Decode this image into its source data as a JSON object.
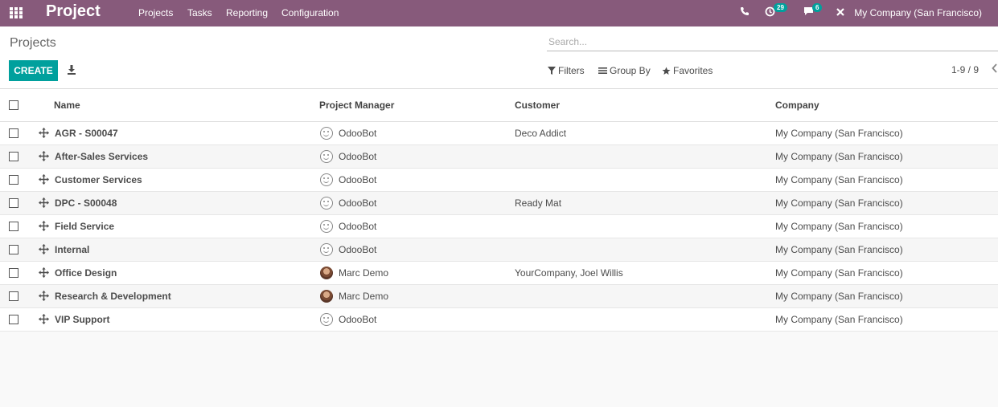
{
  "navbar": {
    "app_title": "Project",
    "menu": [
      "Projects",
      "Tasks",
      "Reporting",
      "Configuration"
    ],
    "activity_badge": "29",
    "messages_badge": "6",
    "company": "My Company (San Francisco)",
    "background_color": "#875a7b"
  },
  "control_panel": {
    "breadcrumb": "Projects",
    "search_placeholder": "Search...",
    "create_label": "CREATE",
    "filters_label": "Filters",
    "group_by_label": "Group By",
    "favorites_label": "Favorites",
    "pager": "1-9 / 9",
    "accent_color": "#00a09d"
  },
  "table": {
    "headers": {
      "name": "Name",
      "manager": "Project Manager",
      "customer": "Customer",
      "company": "Company"
    },
    "rows": [
      {
        "name": "AGR - S00047",
        "manager": "OdooBot",
        "avatar": "bot",
        "customer": "Deco Addict",
        "company": "My Company (San Francisco)"
      },
      {
        "name": "After-Sales Services",
        "manager": "OdooBot",
        "avatar": "bot",
        "customer": "",
        "company": "My Company (San Francisco)"
      },
      {
        "name": "Customer Services",
        "manager": "OdooBot",
        "avatar": "bot",
        "customer": "",
        "company": "My Company (San Francisco)"
      },
      {
        "name": "DPC - S00048",
        "manager": "OdooBot",
        "avatar": "bot",
        "customer": "Ready Mat",
        "company": "My Company (San Francisco)"
      },
      {
        "name": "Field Service",
        "manager": "OdooBot",
        "avatar": "bot",
        "customer": "",
        "company": "My Company (San Francisco)"
      },
      {
        "name": "Internal",
        "manager": "OdooBot",
        "avatar": "bot",
        "customer": "",
        "company": "My Company (San Francisco)"
      },
      {
        "name": "Office Design",
        "manager": "Marc Demo",
        "avatar": "human",
        "customer": "YourCompany, Joel Willis",
        "company": "My Company (San Francisco)"
      },
      {
        "name": "Research & Development",
        "manager": "Marc Demo",
        "avatar": "human",
        "customer": "",
        "company": "My Company (San Francisco)"
      },
      {
        "name": "VIP Support",
        "manager": "OdooBot",
        "avatar": "bot",
        "customer": "",
        "company": "My Company (San Francisco)"
      }
    ]
  }
}
